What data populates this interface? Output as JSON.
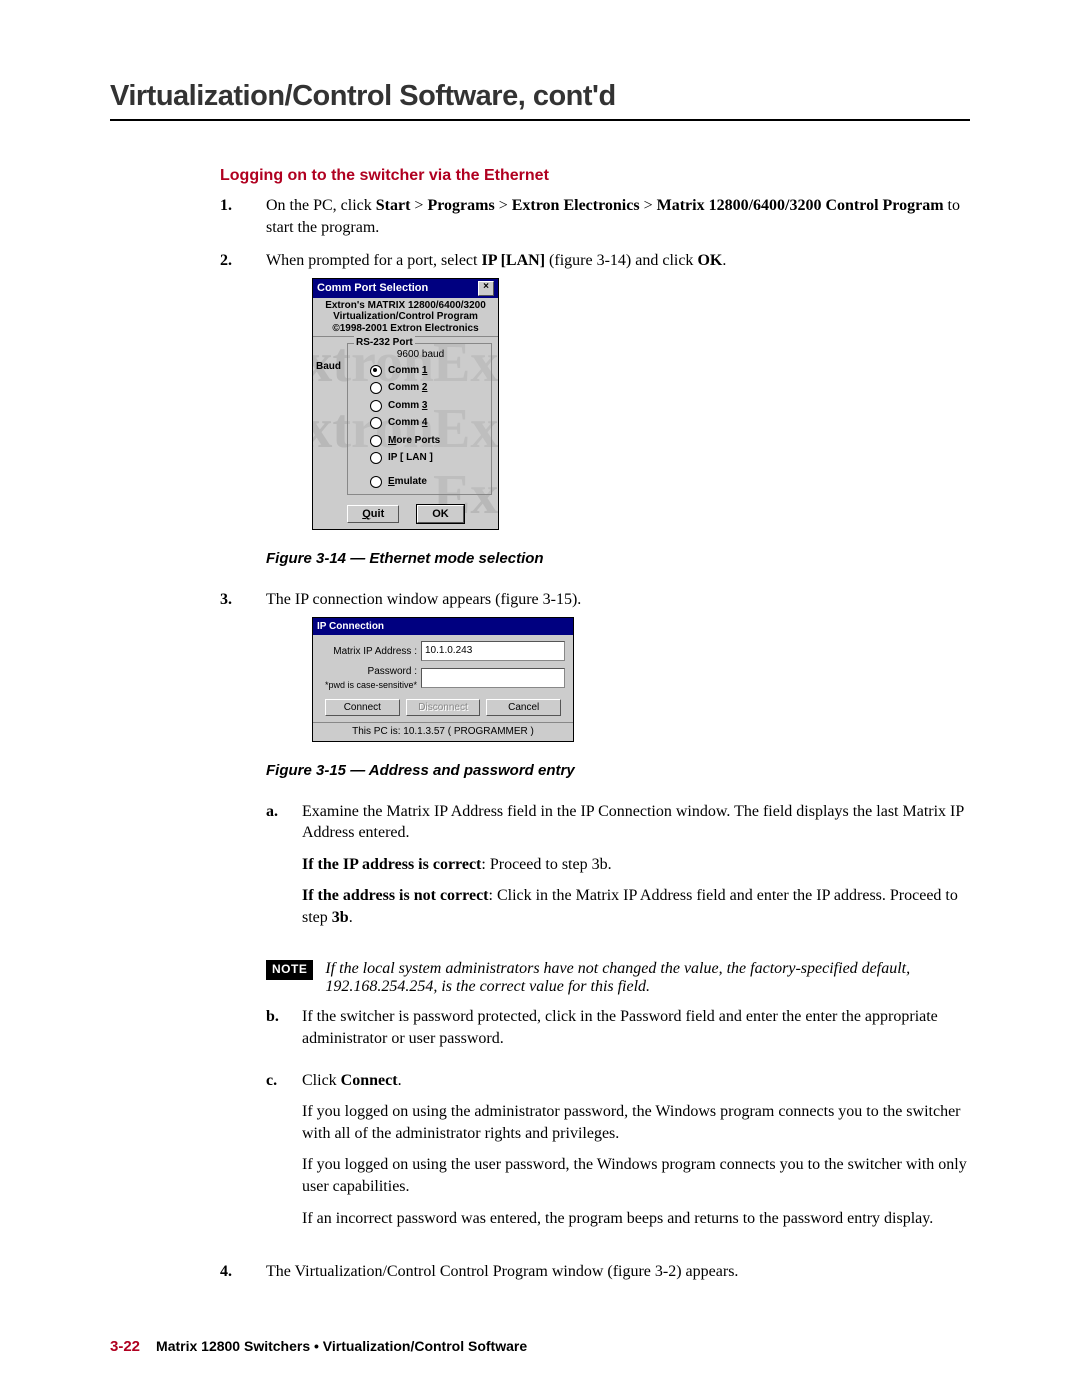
{
  "chapter_title": "Virtualization/Control Software, cont'd",
  "section_title": "Logging on to the switcher via the Ethernet",
  "steps": {
    "s1": {
      "num": "1.",
      "pre": "On the PC, click ",
      "b1": "Start",
      "g1": " > ",
      "b2": "Programs",
      "g2": " > ",
      "b3": "Extron Electronics",
      "g3": " > ",
      "b4": "Matrix 12800/6400/3200 Control Program",
      "post": " to start the program."
    },
    "s2": {
      "num": "2.",
      "pre": "When prompted for a port, select ",
      "b1": "IP  [LAN]",
      "mid": " (figure 3-14) and click ",
      "b2": "OK",
      "post": "."
    },
    "s3": {
      "num": "3.",
      "text": "The IP connection window appears (figure 3-15)."
    },
    "s3a": {
      "num": "a.",
      "p1": "Examine the Matrix IP Address field in the IP Connection window.  The field displays the last Matrix IP Address entered.",
      "p2_b": "If the IP address is correct",
      "p2_r": ": Proceed to step 3b.",
      "p3_b": "If the address is not correct",
      "p3_r1": ": Click in the Matrix IP Address field and enter the IP address.  Proceed to step ",
      "p3_b2": "3b",
      "p3_r2": "."
    },
    "note": {
      "badge": "NOTE",
      "text": "If the local system administrators have not changed the value, the factory-specified default, 192.168.254.254, is the correct value for this field."
    },
    "s3b": {
      "num": "b.",
      "text": "If the switcher is password protected, click in the Password field and enter the enter the appropriate administrator or user password."
    },
    "s3c": {
      "num": "c.",
      "pre": "Click ",
      "b1": "Connect",
      "post": ".",
      "p2": "If you logged on using the administrator password, the Windows program connects you to the switcher with all of the administrator rights and privileges.",
      "p3": "If you logged on using the user password, the Windows program connects you to the switcher with only user capabilities.",
      "p4": "If an incorrect password was entered, the program beeps and returns to the password entry display."
    },
    "s4": {
      "num": "4.",
      "text": "The Virtualization/Control Control Program window (figure 3-2) appears."
    }
  },
  "fig314": {
    "caption": "Figure 3-14 — Ethernet mode selection",
    "title": "Comm Port Selection",
    "banner1": "Extron's MATRIX 12800/6400/3200",
    "banner2": "Virtualization/Control Program",
    "banner3": "©1998-2001 Extron Electronics",
    "group_label": "RS-232 Port",
    "baud_label": "Baud",
    "baud_value": "9600 baud",
    "options": {
      "o1": {
        "pre": "Comm ",
        "u": "1"
      },
      "o2": {
        "pre": "Comm ",
        "u": "2"
      },
      "o3": {
        "pre": "Comm ",
        "u": "3"
      },
      "o4": {
        "pre": "Comm ",
        "u": "4"
      },
      "o5": {
        "pre": "",
        "u": "M",
        "post": "ore Ports"
      },
      "o6": {
        "pre": "IP  [ LAN ]"
      },
      "o7": {
        "pre": "",
        "u": "E",
        "post": "mulate"
      }
    },
    "quit_u": "Q",
    "quit_rest": "uit",
    "ok": "OK",
    "wm": "Extron"
  },
  "fig315": {
    "caption": "Figure 3-15 — Address and password entry",
    "title": "IP Connection",
    "ip_label": "Matrix IP Address :",
    "ip_value": "10.1.0.243",
    "pwd_label": "Password :",
    "pwd_hint": "*pwd is case-sensitive*",
    "pwd_value": "",
    "btn_connect": "Connect",
    "btn_disconnect": "Disconnect",
    "btn_cancel": "Cancel",
    "status": "This PC is:   10.1.3.57   ( PROGRAMMER )"
  },
  "footer": {
    "page": "3-22",
    "text": "Matrix 12800 Switchers • Virtualization/Control Software"
  }
}
